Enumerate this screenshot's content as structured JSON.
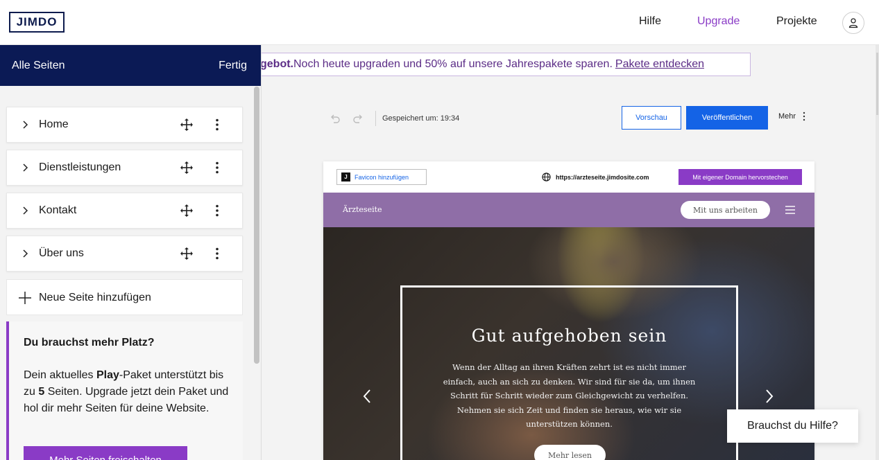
{
  "topbar": {
    "logo": "JIMDO",
    "nav": {
      "help": "Hilfe",
      "upgrade": "Upgrade",
      "projects": "Projekte"
    }
  },
  "promo": {
    "bold": "gebot.",
    "text": " Noch heute upgraden und 50% auf unsere Jahrespakete sparen.",
    "link": "Pakete entdecken"
  },
  "sidebar": {
    "title": "Alle Seiten",
    "done": "Fertig",
    "pages": [
      {
        "label": "Home"
      },
      {
        "label": "Dienstleistungen"
      },
      {
        "label": "Kontakt"
      },
      {
        "label": "Über uns"
      }
    ],
    "add_page": "Neue Seite hinzufügen",
    "upsell": {
      "heading": "Du brauchst mehr Platz?",
      "text_1": "Dein aktuelles ",
      "plan": "Play",
      "text_2": "-Paket unterstützt bis zu ",
      "limit": "5",
      "text_3": " Seiten. Upgrade jetzt dein Paket und hol dir mehr Seiten für deine Website.",
      "cta": "Mehr Seiten freischalten"
    }
  },
  "toolbar": {
    "saved": "Gespeichert um: 19:34",
    "preview": "Vorschau",
    "publish": "Veröffentlichen",
    "more": "Mehr"
  },
  "site": {
    "favicon": "Favicon hinzufügen",
    "favicon_letter": "J",
    "domain": "https://arzteseite.jimdosite.com",
    "domain_cta": "Mit eigener Domain hervorstechen",
    "name": "Ärzteseite",
    "nav_cta": "Mit uns arbeiten",
    "hero": {
      "title": "Gut aufgehoben sein",
      "text": "Wenn der Alltag an ihren Kräften zehrt ist es nicht immer einfach, auch an sich zu denken. Wir sind für sie da, um ihnen Schritt für Schritt wieder zum Gleichgewicht zu verhelfen. Nehmen sie sich Zeit und finden sie heraus, wie wir sie unterstützen können.",
      "button": "Mehr lesen"
    }
  },
  "help_widget": "Brauchst du Hilfe?",
  "colors": {
    "navy": "#0b1a55",
    "purple": "#8a3bc6",
    "blue": "#1463e6",
    "site_nav": "#8f6ea7"
  }
}
